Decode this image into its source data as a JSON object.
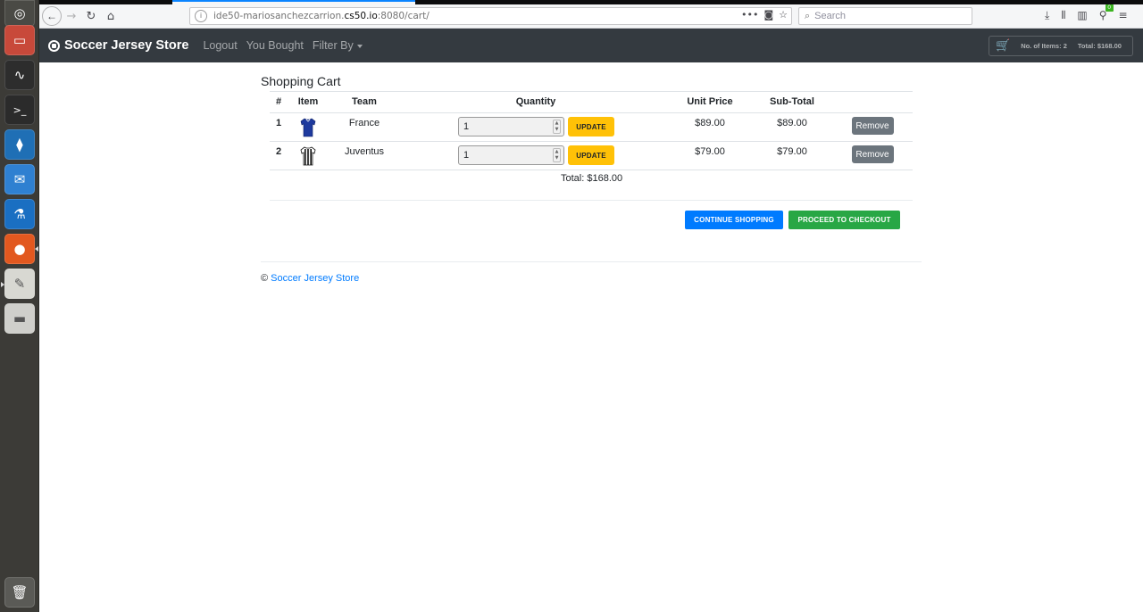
{
  "browser": {
    "url_prefix": "ide50-mariosanchezcarrion.",
    "url_domain": "cs50.io",
    "url_suffix": ":8080/cart/",
    "search_placeholder": "Search",
    "ext_badge": "0"
  },
  "launcher": {
    "apps": [
      "dash",
      "files",
      "system-monitor",
      "terminal",
      "vscode",
      "thunderbird",
      "lab",
      "firefox",
      "text-editor",
      "drive",
      "trash"
    ]
  },
  "nav": {
    "brand": "Soccer Jersey Store",
    "links": [
      "Logout",
      "You Bought",
      "Filter By"
    ],
    "cart_items": "No. of Items: 2",
    "cart_total": "Total: $168.00"
  },
  "cart": {
    "title": "Shopping Cart",
    "headers": [
      "#",
      "Item",
      "Team",
      "Quantity",
      "Unit Price",
      "Sub-Total"
    ],
    "rows": [
      {
        "num": "1",
        "team": "France",
        "qty": "1",
        "price": "$89.00",
        "subtotal": "$89.00",
        "update": "UPDATE",
        "remove": "Remove"
      },
      {
        "num": "2",
        "team": "Juventus",
        "qty": "1",
        "price": "$79.00",
        "subtotal": "$79.00",
        "update": "UPDATE",
        "remove": "Remove"
      }
    ],
    "total": "Total: $168.00",
    "continue_label": "CONTINUE SHOPPING",
    "checkout_label": "PROCEED TO CHECKOUT"
  },
  "footer": {
    "copy": "©",
    "link": "Soccer Jersey Store"
  },
  "colors": {
    "navbar": "#343a40",
    "update": "#ffc107",
    "remove": "#6c757d",
    "continue": "#007bff",
    "checkout": "#28a745",
    "france_jersey": "#1e3a9e",
    "juventus_jersey": "#111111"
  }
}
